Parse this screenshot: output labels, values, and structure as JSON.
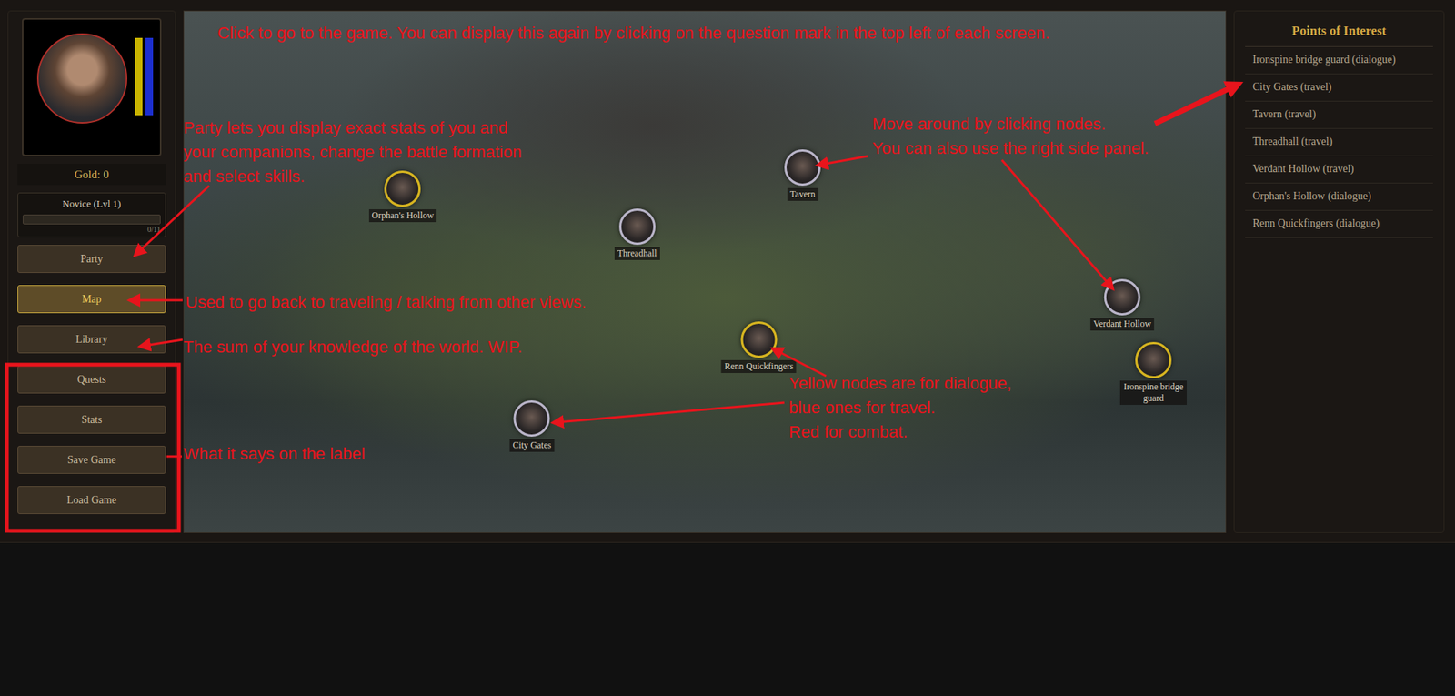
{
  "sidebar": {
    "vitals": [
      {
        "name": "health",
        "level": 1,
        "color": "#c9b400"
      },
      {
        "name": "mana",
        "level": 1,
        "color": "#1c2fd0"
      }
    ],
    "gold": "Gold: 0",
    "rank": {
      "title": "Novice (Lvl 1)",
      "level": 0,
      "reading": "0/11"
    },
    "menu": [
      {
        "label": "Party",
        "selected": false
      },
      {
        "label": "Map",
        "selected": true
      },
      {
        "label": "Library",
        "selected": false
      },
      {
        "label": "Quests",
        "selected": false
      },
      {
        "label": "Stats",
        "selected": false
      },
      {
        "label": "Save Game",
        "selected": false
      },
      {
        "label": "Load Game",
        "selected": false
      }
    ]
  },
  "map": {
    "nodes": [
      {
        "label": "Orphan's Hollow",
        "kind": "dialogue"
      },
      {
        "label": "Threadhall",
        "kind": "travel"
      },
      {
        "label": "Tavern",
        "kind": "travel"
      },
      {
        "label": "Verdant Hollow",
        "kind": "travel"
      },
      {
        "label": "Ironspine bridge guard",
        "kind": "dialogue"
      },
      {
        "label": "Renn Quickfingers",
        "kind": "dialogue"
      },
      {
        "label": "City Gates",
        "kind": "travel"
      }
    ]
  },
  "points_of_interest": {
    "title": "Points of Interest",
    "items": [
      "Ironspine bridge guard (dialogue)",
      "City Gates (travel)",
      "Tavern (travel)",
      "Threadhall (travel)",
      "Verdant Hollow (travel)",
      "Orphan's Hollow (dialogue)",
      "Renn Quickfingers (dialogue)"
    ]
  },
  "annotations": [
    {
      "lines": [
        "Click to go to the game. You can display this again by clicking on the question mark in the top left of each screen."
      ]
    },
    {
      "lines": [
        "Party lets you display exact stats of you and",
        "your companions, change the battle formation",
        "and select skills."
      ]
    },
    {
      "lines": [
        "Used to go back to traveling / talking from other views."
      ]
    },
    {
      "lines": [
        "The sum of your knowledge of the world. WIP."
      ]
    },
    {
      "lines": [
        "What it says on the label"
      ]
    },
    {
      "lines": [
        "Move around by clicking nodes.",
        "You can also use the right side panel."
      ]
    },
    {
      "lines": [
        "Yellow nodes are for dialogue,",
        "blue ones for travel.",
        "Red for combat."
      ]
    }
  ]
}
